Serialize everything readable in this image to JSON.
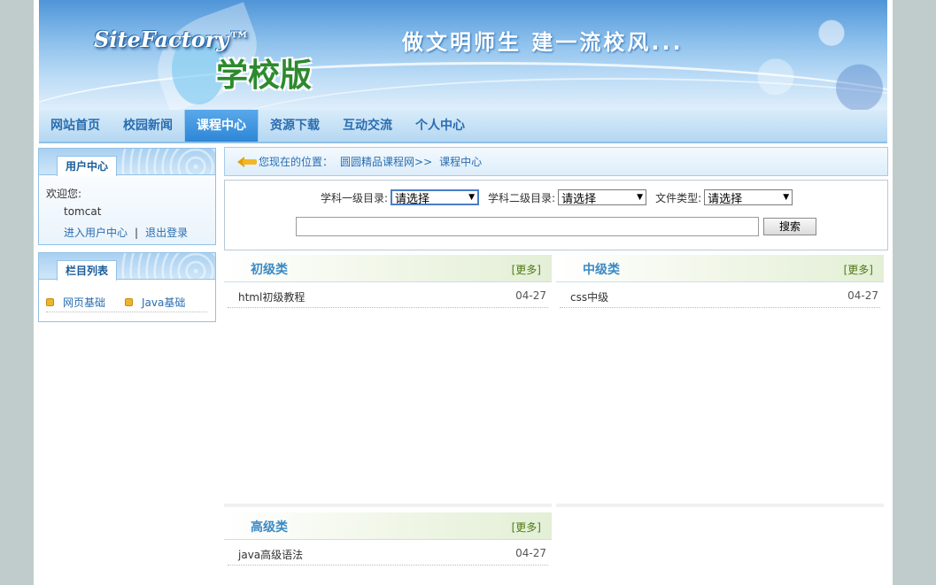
{
  "header": {
    "logo_en": "SiteFactory™",
    "logo_cn": "学校版",
    "slogan": "做文明师生  建一流校风..."
  },
  "nav": {
    "items": [
      {
        "label": "网站首页"
      },
      {
        "label": "校园新闻"
      },
      {
        "label": "课程中心"
      },
      {
        "label": "资源下载"
      },
      {
        "label": "互动交流"
      },
      {
        "label": "个人中心"
      }
    ],
    "active": "课程中心"
  },
  "user_box": {
    "tab": "用户中心",
    "welcome": "欢迎您:",
    "username": "tomcat",
    "enter_link": "进入用户中心",
    "separator": "|",
    "logout_link": "退出登录"
  },
  "column_box": {
    "tab": "栏目列表",
    "items": [
      {
        "label": "网页基础"
      },
      {
        "label": "Java基础"
      }
    ]
  },
  "breadcrumb": {
    "prefix": "您现在的位置：",
    "site": "圆圆精品课程网",
    "sep": ">>",
    "current": "课程中心"
  },
  "search": {
    "level1_label": "学科一级目录:",
    "level1_value": "请选择",
    "level2_label": "学科二级目录:",
    "level2_value": "请选择",
    "filetype_label": "文件类型:",
    "filetype_value": "请选择",
    "keyword_value": "",
    "button_label": "搜索"
  },
  "panels": [
    {
      "title": "初级类",
      "more": "[更多]",
      "rows": [
        {
          "title": "html初级教程",
          "date": "04-27"
        }
      ]
    },
    {
      "title": "中级类",
      "more": "[更多]",
      "rows": [
        {
          "title": "css中级",
          "date": "04-27"
        }
      ]
    },
    {
      "title": "高级类",
      "more": "[更多]",
      "rows": [
        {
          "title": "java高级语法",
          "date": "04-27"
        }
      ]
    }
  ],
  "colors": {
    "nav_active": "#2e86d6",
    "link": "#2a6db0",
    "panel_title": "#3b8ac4",
    "more": "#4d7a12",
    "page_bg": "#c0cccc"
  }
}
